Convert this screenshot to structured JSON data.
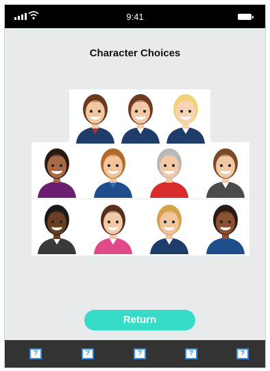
{
  "status_bar": {
    "time": "9:41"
  },
  "title": "Character Choices",
  "return_button": {
    "label": "Return"
  },
  "tab_bar": {
    "icons": [
      "?",
      "?",
      "?",
      "?",
      "?"
    ]
  },
  "characters": [
    {
      "row": 1,
      "name": "man-red-tie-avatar",
      "skin": "#f2c7a0",
      "hair": "#6b3a1e",
      "shirt": "#1e3d6b",
      "accent": "#c62828"
    },
    {
      "row": 1,
      "name": "woman-brown-hair-avatar",
      "skin": "#f3c8a6",
      "hair": "#6e3b22",
      "shirt": "#1e3d6b",
      "accent": "#ffffff"
    },
    {
      "row": 1,
      "name": "woman-blonde-avatar",
      "skin": "#f6d3b4",
      "hair": "#f1d27a",
      "shirt": "#1e3d6b",
      "accent": "#ffffff"
    },
    {
      "row": 2,
      "name": "woman-dark-hair-avatar",
      "skin": "#a86a46",
      "hair": "#2a1a12",
      "shirt": "#6a1f6f",
      "accent": "#6a1f6f"
    },
    {
      "row": 2,
      "name": "man-glasses-avatar",
      "skin": "#f1c49c",
      "hair": "#b06a2c",
      "shirt": "#1f4e8c",
      "accent": "#2c6fb5"
    },
    {
      "row": 2,
      "name": "woman-gray-hair-avatar",
      "skin": "#f2c8a6",
      "hair": "#b8b8b8",
      "shirt": "#d62c2c",
      "accent": "#d62c2c"
    },
    {
      "row": 2,
      "name": "man-brown-hair-avatar",
      "skin": "#f0c8a4",
      "hair": "#7a4a28",
      "shirt": "#4b4b4b",
      "accent": "#ffffff"
    },
    {
      "row": 3,
      "name": "man-dark-skin-avatar",
      "skin": "#6b3e22",
      "hair": "#1a1a1a",
      "shirt": "#3a3a3a",
      "accent": "#ffffff"
    },
    {
      "row": 3,
      "name": "woman-pink-headband-avatar",
      "skin": "#f3c8a6",
      "hair": "#5a2e1c",
      "shirt": "#e04a8a",
      "accent": "#ffffff"
    },
    {
      "row": 3,
      "name": "man-blonde-avatar",
      "skin": "#f1c49c",
      "hair": "#d4a24a",
      "shirt": "#1e3d6b",
      "accent": "#ffffff"
    },
    {
      "row": 3,
      "name": "woman-bun-avatar",
      "skin": "#8a5232",
      "hair": "#2a1a12",
      "shirt": "#1f4e8c",
      "accent": "#1f4e8c"
    }
  ]
}
